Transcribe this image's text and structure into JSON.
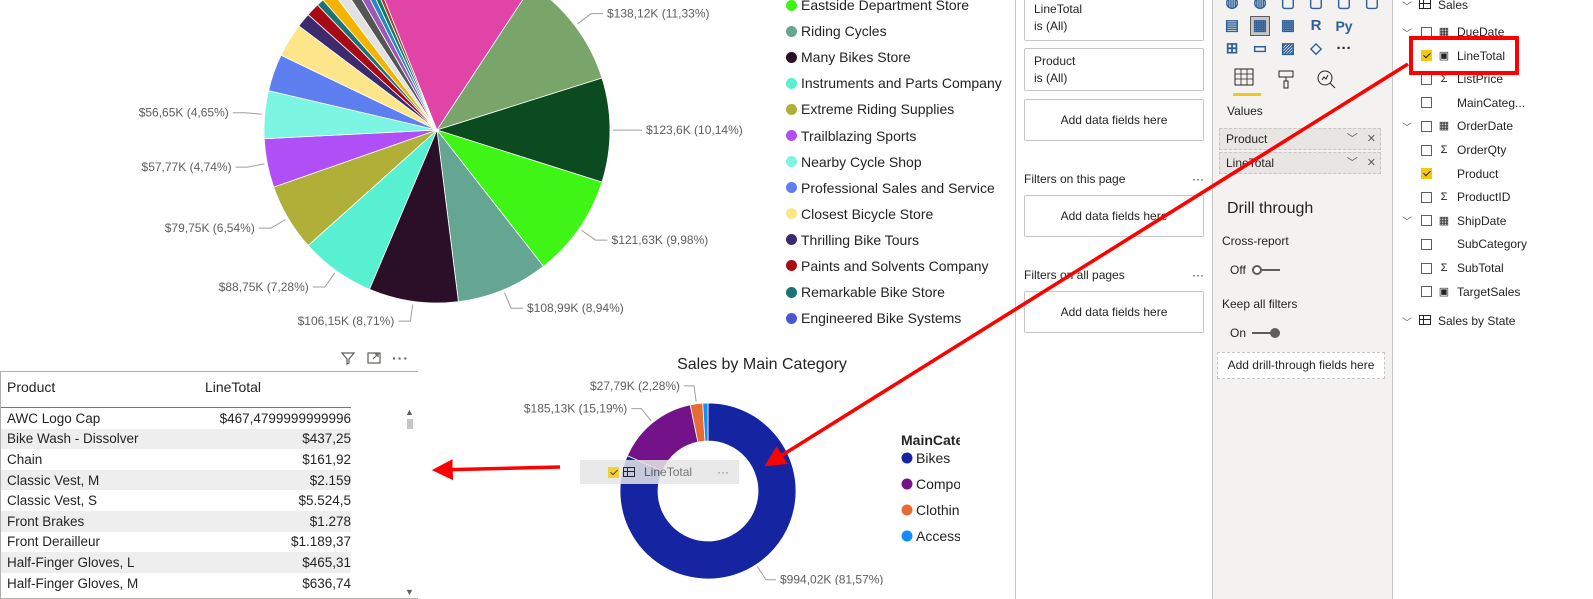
{
  "pie": {
    "slices": [
      {
        "label": "",
        "value": 1.2,
        "color": "#f2b400"
      },
      {
        "label": "",
        "value": 1.1,
        "color": "#e2e2e2"
      },
      {
        "label": "",
        "value": 1.0,
        "color": "#555555"
      },
      {
        "label": "",
        "value": 0.8,
        "color": "#9b59b6"
      },
      {
        "label": "",
        "value": 0.6,
        "color": "#2e86c1"
      },
      {
        "label": "",
        "value": 0.5,
        "color": "#117a65"
      },
      {
        "label": "",
        "value": 0.4,
        "color": "#b03a2e"
      },
      {
        "label": "",
        "value": 16.0,
        "color": "#e044a7"
      },
      {
        "label": "$138,12K (11,33%)",
        "value": 11.33,
        "color": "#79a56a"
      },
      {
        "label": "$123,6K (10,14%)",
        "value": 10.14,
        "color": "#0c4b20"
      },
      {
        "label": "$121,63K (9,98%)",
        "value": 9.98,
        "color": "#3ef515"
      },
      {
        "label": "$108,99K (8,94%)",
        "value": 8.94,
        "color": "#65a693"
      },
      {
        "label": "$106,15K (8,71%)",
        "value": 8.71,
        "color": "#2b0f28"
      },
      {
        "label": "$88,75K (7,28%)",
        "value": 7.28,
        "color": "#57f0d0"
      },
      {
        "label": "$79,75K (6,54%)",
        "value": 6.54,
        "color": "#b0b038"
      },
      {
        "label": "$57,77K (4,74%)",
        "value": 4.74,
        "color": "#b14ff6"
      },
      {
        "label": "$56,65K (4,65%)",
        "value": 4.65,
        "color": "#7cf6e2"
      },
      {
        "label": "",
        "value": 3.6,
        "color": "#5d7ff0"
      },
      {
        "label": "",
        "value": 3.3,
        "color": "#fde68a"
      },
      {
        "label": "",
        "value": 1.4,
        "color": "#3d2a6c"
      },
      {
        "label": "",
        "value": 1.3,
        "color": "#a80a15"
      },
      {
        "label": "",
        "value": 0.7,
        "color": "#1d7272"
      }
    ]
  },
  "legend": {
    "items": [
      {
        "label": "Eastside Department Store",
        "color": "#3ef515"
      },
      {
        "label": "Riding Cycles",
        "color": "#65a693"
      },
      {
        "label": "Many Bikes Store",
        "color": "#2b0f28"
      },
      {
        "label": "Instruments and Parts Company",
        "color": "#57f0d0"
      },
      {
        "label": "Extreme Riding Supplies",
        "color": "#b0b038"
      },
      {
        "label": "Trailblazing Sports",
        "color": "#b14ff6"
      },
      {
        "label": "Nearby Cycle Shop",
        "color": "#7cf6e2"
      },
      {
        "label": "Professional Sales and Service",
        "color": "#5d7ff0"
      },
      {
        "label": "Closest Bicycle Store",
        "color": "#fde68a"
      },
      {
        "label": "Thrilling Bike Tours",
        "color": "#3d2a6c"
      },
      {
        "label": "Paints and Solvents Company",
        "color": "#a80a15"
      },
      {
        "label": "Remarkable Bike Store",
        "color": "#1d7272"
      },
      {
        "label": "Engineered Bike Systems",
        "color": "#4a57d0"
      }
    ]
  },
  "table": {
    "headers": [
      "Product",
      "LineTotal"
    ],
    "rows": [
      [
        "AWC Logo Cap",
        "$467,4799999999996"
      ],
      [
        "Bike Wash - Dissolver",
        "$437,25"
      ],
      [
        "Chain",
        "$161,92"
      ],
      [
        "Classic Vest, M",
        "$2.159"
      ],
      [
        "Classic Vest, S",
        "$5.524,5"
      ],
      [
        "Front Brakes",
        "$1.278"
      ],
      [
        "Front Derailleur",
        "$1.189,37"
      ],
      [
        "Half-Finger Gloves, L",
        "$465,31"
      ],
      [
        "Half-Finger Gloves, M",
        "$636,74"
      ]
    ]
  },
  "donut": {
    "title": "Sales by Main Category",
    "legend_title": "MainCategory",
    "segments": [
      {
        "name": "Bikes",
        "value": 81.57,
        "label": "$994,02K (81,57%)",
        "color": "#1524a0"
      },
      {
        "name": "Components",
        "value": 15.19,
        "label": "$185,13K (15,19%)",
        "color": "#74128a"
      },
      {
        "name": "Clothing",
        "value": 2.28,
        "label": "$27,79K (2,28%)",
        "color": "#e66c37"
      },
      {
        "name": "Accessories",
        "value": 0.96,
        "label": "",
        "color": "#118dff"
      }
    ]
  },
  "drag_ghost": {
    "label": "LineTotal",
    "more": "···"
  },
  "filters": {
    "cards": [
      {
        "name": "LineTotal",
        "state": "is (All)"
      },
      {
        "name": "Product",
        "state": "is (All)"
      }
    ],
    "add_label": "Add data fields here",
    "page_section": "Filters on this page",
    "all_section": "Filters on all pages",
    "more": "···"
  },
  "viz": {
    "values_label": "Values",
    "wells": [
      "Product",
      "LineTotal"
    ],
    "drill_title": "Drill through",
    "cross_report": "Cross-report",
    "off": "Off",
    "keep_filters": "Keep all filters",
    "on": "On",
    "add_drill": "Add drill-through fields here"
  },
  "fields": {
    "table_name": "Sales",
    "items": [
      {
        "name": "DueDate",
        "type": "date",
        "checked": false,
        "expand": true
      },
      {
        "name": "LineTotal",
        "type": "calc",
        "checked": true,
        "expand": false
      },
      {
        "name": "ListPrice",
        "type": "sum",
        "checked": false,
        "expand": false
      },
      {
        "name": "MainCateg...",
        "type": "none",
        "checked": false,
        "expand": false
      },
      {
        "name": "OrderDate",
        "type": "date",
        "checked": false,
        "expand": true
      },
      {
        "name": "OrderQty",
        "type": "sum",
        "checked": false,
        "expand": false
      },
      {
        "name": "Product",
        "type": "none",
        "checked": true,
        "expand": false
      },
      {
        "name": "ProductID",
        "type": "sum",
        "checked": false,
        "expand": false
      },
      {
        "name": "ShipDate",
        "type": "date",
        "checked": false,
        "expand": true
      },
      {
        "name": "SubCategory",
        "type": "none",
        "checked": false,
        "expand": false
      },
      {
        "name": "SubTotal",
        "type": "sum",
        "checked": false,
        "expand": false
      },
      {
        "name": "TargetSales",
        "type": "calc",
        "checked": false,
        "expand": false
      }
    ],
    "sales_by_state": "Sales by State"
  },
  "annotation_color": "#ff0000"
}
